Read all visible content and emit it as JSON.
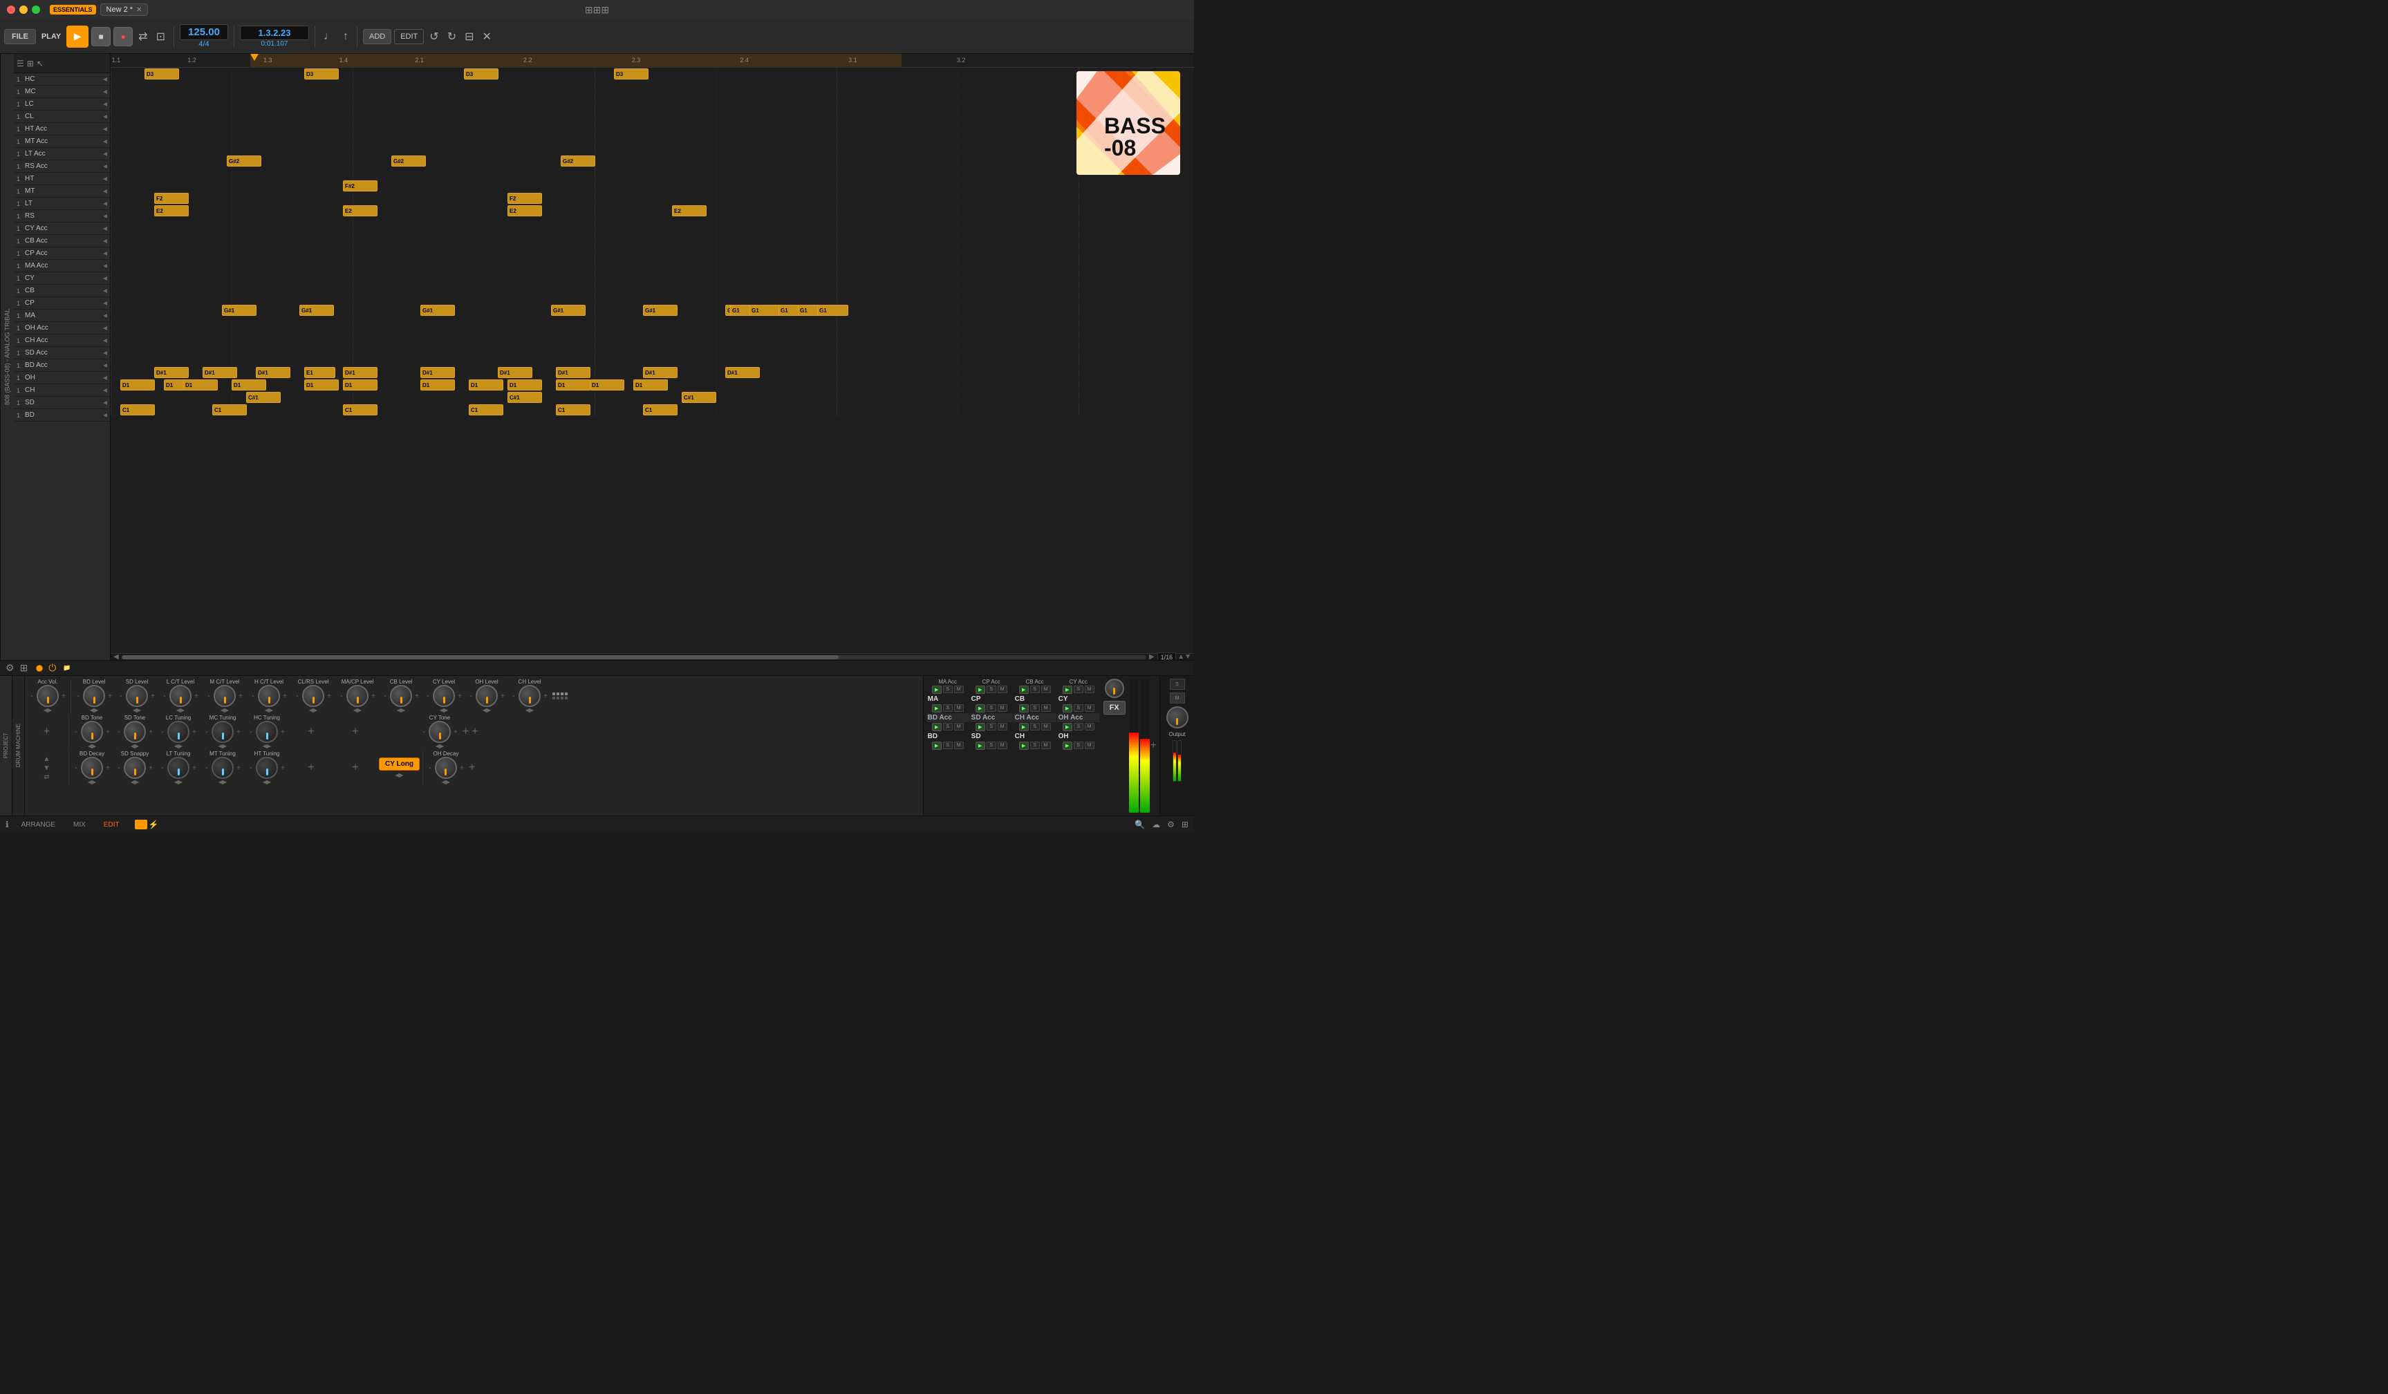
{
  "titlebar": {
    "essentials_label": "ESSENTIALS",
    "tab_label": "New 2 *",
    "close_label": "✕",
    "grid_icon": "⊞"
  },
  "toolbar": {
    "file_label": "FILE",
    "play_label": "PLAY",
    "play_icon": "▶",
    "stop_icon": "■",
    "record_icon": "●",
    "loop_icon": "↺",
    "midi_icon": "⇄",
    "pattern_icon": "⊡",
    "bpm_value": "125.00",
    "time_sig": "4/4",
    "position": "1.3.2.23",
    "time": "0:01.107",
    "metronome_icon": "♩",
    "add_label": "ADD",
    "edit_label": "EDIT",
    "undo_icon": "↺",
    "redo_icon": "↻",
    "save_icon": "⊟",
    "settings_icon": "✕"
  },
  "arrange": {
    "markers": [
      {
        "label": "1.1",
        "pos_pct": 0
      },
      {
        "label": "1.4",
        "pos_pct": 10.5
      },
      {
        "label": "1.4",
        "pos_pct": 13.5
      },
      {
        "label": "2.1",
        "pos_pct": 27
      },
      {
        "label": "2.2",
        "pos_pct": 36
      },
      {
        "label": "2.3",
        "pos_pct": 46
      },
      {
        "label": "2.4",
        "pos_pct": 56
      },
      {
        "label": "3.1",
        "pos_pct": 66
      },
      {
        "label": "3.2",
        "pos_pct": 76
      }
    ],
    "grid_size": "1/16"
  },
  "tracks": [
    {
      "num": "1",
      "name": "HC"
    },
    {
      "num": "1",
      "name": "MC"
    },
    {
      "num": "1",
      "name": "LC"
    },
    {
      "num": "1",
      "name": "CL"
    },
    {
      "num": "1",
      "name": "HT Acc"
    },
    {
      "num": "1",
      "name": "MT Acc"
    },
    {
      "num": "1",
      "name": "LT Acc"
    },
    {
      "num": "1",
      "name": "RS Acc"
    },
    {
      "num": "1",
      "name": "HT"
    },
    {
      "num": "1",
      "name": "MT"
    },
    {
      "num": "1",
      "name": "LT"
    },
    {
      "num": "1",
      "name": "RS"
    },
    {
      "num": "1",
      "name": "CY Acc"
    },
    {
      "num": "1",
      "name": "CB Acc"
    },
    {
      "num": "1",
      "name": "CP Acc"
    },
    {
      "num": "1",
      "name": "MA Acc"
    },
    {
      "num": "1",
      "name": "CY"
    },
    {
      "num": "1",
      "name": "CB"
    },
    {
      "num": "1",
      "name": "CP"
    },
    {
      "num": "1",
      "name": "MA"
    },
    {
      "num": "1",
      "name": "OH Acc"
    },
    {
      "num": "1",
      "name": "CH Acc"
    },
    {
      "num": "1",
      "name": "SD Acc"
    },
    {
      "num": "1",
      "name": "BD Acc"
    },
    {
      "num": "1",
      "name": "OH"
    },
    {
      "num": "1",
      "name": "CH"
    },
    {
      "num": "1",
      "name": "SD"
    },
    {
      "num": "1",
      "name": "BD"
    }
  ],
  "patterns": [
    {
      "track": 1,
      "note": "D3",
      "col": 0
    },
    {
      "track": 1,
      "note": "D3",
      "col": 18
    },
    {
      "track": 1,
      "note": "D3",
      "col": 36
    },
    {
      "track": 1,
      "note": "D3",
      "col": 54
    },
    {
      "track": 8,
      "note": "G#2",
      "col": 9
    },
    {
      "track": 8,
      "note": "G#2",
      "col": 27
    },
    {
      "track": 8,
      "note": "G#2",
      "col": 45
    },
    {
      "track": 10,
      "note": "F#2",
      "col": 22
    },
    {
      "track": 11,
      "note": "F2",
      "col": 3
    },
    {
      "track": 11,
      "note": "F2",
      "col": 40
    },
    {
      "track": 12,
      "note": "E2",
      "col": 3
    },
    {
      "track": 12,
      "note": "E2",
      "col": 22
    },
    {
      "track": 12,
      "note": "E2",
      "col": 40
    },
    {
      "track": 12,
      "note": "E2",
      "col": 58
    },
    {
      "track": 20,
      "note": "G#1",
      "col": 8
    },
    {
      "track": 20,
      "note": "G#1",
      "col": 16
    },
    {
      "track": 20,
      "note": "G#1",
      "col": 30
    },
    {
      "track": 20,
      "note": "G#1",
      "col": 44
    },
    {
      "track": 20,
      "note": "G#1",
      "col": 53
    },
    {
      "track": 20,
      "note": "G#1",
      "col": 62
    },
    {
      "track": 25,
      "note": "D#1",
      "col": 3
    },
    {
      "track": 25,
      "note": "D#1",
      "col": 8
    },
    {
      "track": 25,
      "note": "D#1",
      "col": 13
    },
    {
      "track": 25,
      "note": "D#1",
      "col": 22
    },
    {
      "track": 25,
      "note": "D#1",
      "col": 30
    },
    {
      "track": 25,
      "note": "D#1",
      "col": 38
    },
    {
      "track": 25,
      "note": "D#1",
      "col": 44
    },
    {
      "track": 25,
      "note": "D#1",
      "col": 53
    },
    {
      "track": 25,
      "note": "D#1",
      "col": 62
    },
    {
      "track": 26,
      "note": "D1",
      "col": 0
    },
    {
      "track": 26,
      "note": "D1",
      "col": 4
    },
    {
      "track": 26,
      "note": "D1",
      "col": 6
    },
    {
      "track": 26,
      "note": "D1",
      "col": 11
    },
    {
      "track": 26,
      "note": "D1",
      "col": 18
    },
    {
      "track": 26,
      "note": "D1",
      "col": 22
    },
    {
      "track": 26,
      "note": "D1",
      "col": 30
    },
    {
      "track": 26,
      "note": "D1",
      "col": 36
    },
    {
      "track": 26,
      "note": "D1",
      "col": 40
    },
    {
      "track": 26,
      "note": "D1",
      "col": 44
    },
    {
      "track": 26,
      "note": "D1",
      "col": 48
    },
    {
      "track": 26,
      "note": "D1",
      "col": 53
    },
    {
      "track": 27,
      "note": "C#1",
      "col": 12
    },
    {
      "track": 27,
      "note": "C#1",
      "col": 40
    },
    {
      "track": 27,
      "note": "C#1",
      "col": 58
    },
    {
      "track": 28,
      "note": "C1",
      "col": 0
    },
    {
      "track": 28,
      "note": "C1",
      "col": 9
    },
    {
      "track": 28,
      "note": "C1",
      "col": 22
    },
    {
      "track": 28,
      "note": "C1",
      "col": 36
    },
    {
      "track": 28,
      "note": "C1",
      "col": 44
    },
    {
      "track": 28,
      "note": "C1",
      "col": 54
    }
  ],
  "mixer": {
    "knobs": [
      {
        "label": "Acc Vol.",
        "type": "orange"
      },
      {
        "label": "BD Level",
        "type": "orange"
      },
      {
        "label": "SD Level",
        "type": "orange"
      },
      {
        "label": "L C/T Level",
        "type": "orange"
      },
      {
        "label": "M C/T Level",
        "type": "orange"
      },
      {
        "label": "H C/T Level",
        "type": "orange"
      },
      {
        "label": "CL/RS Level",
        "type": "orange"
      },
      {
        "label": "MA/CP Level",
        "type": "orange"
      },
      {
        "label": "CB Level",
        "type": "orange"
      },
      {
        "label": "CY Level",
        "type": "orange"
      },
      {
        "label": "OH Level",
        "type": "orange"
      },
      {
        "label": "CH Level",
        "type": "orange"
      }
    ],
    "knobs2": [
      {
        "label": "BD Tone",
        "type": "orange"
      },
      {
        "label": "SD Tone",
        "type": "orange"
      },
      {
        "label": "LC Tuning",
        "type": "dark"
      },
      {
        "label": "MC Tuning",
        "type": "dark"
      },
      {
        "label": "HC Tuning",
        "type": "dark"
      },
      {
        "label": "",
        "type": "none"
      },
      {
        "label": "",
        "type": "none"
      },
      {
        "label": "CY Tone",
        "type": "orange"
      }
    ],
    "knobs3": [
      {
        "label": "BD Decay",
        "type": "orange"
      },
      {
        "label": "SD Snappy",
        "type": "orange"
      },
      {
        "label": "LT Tuning",
        "type": "dark"
      },
      {
        "label": "MT Tuning",
        "type": "dark"
      },
      {
        "label": "HT Tuning",
        "type": "dark"
      },
      {
        "label": "",
        "type": "none"
      },
      {
        "label": "",
        "type": "none"
      },
      {
        "label": "OH Decay",
        "type": "orange"
      }
    ]
  },
  "channel_strips": [
    {
      "label": "MA Acc",
      "name": "MA"
    },
    {
      "label": "CP Acc",
      "name": "CP"
    },
    {
      "label": "CB Acc",
      "name": "CB"
    },
    {
      "label": "CY Acc",
      "name": "CY"
    },
    {
      "label": "BD Acc",
      "name": "BD"
    },
    {
      "label": "SD Acc",
      "name": "SD"
    },
    {
      "label": "CH Acc",
      "name": "CH"
    },
    {
      "label": "OH Acc",
      "name": "OH"
    }
  ],
  "bottom_strips": [
    {
      "name": "BD"
    },
    {
      "name": "SD"
    },
    {
      "name": "CH"
    },
    {
      "name": "OH"
    }
  ],
  "cover": {
    "title": "BASS",
    "subtitle": "-08"
  },
  "cy_long_label": "CY Long",
  "oh_decay_label": "OH Decay",
  "fx_label": "FX",
  "output_label": "Output",
  "statusbar": {
    "info_icon": "ℹ",
    "arrange_label": "ARRANGE",
    "mix_label": "MIX",
    "edit_label": "EDIT",
    "search_icon": "🔍",
    "save_icon": "💾",
    "settings_icon": "⚙"
  }
}
